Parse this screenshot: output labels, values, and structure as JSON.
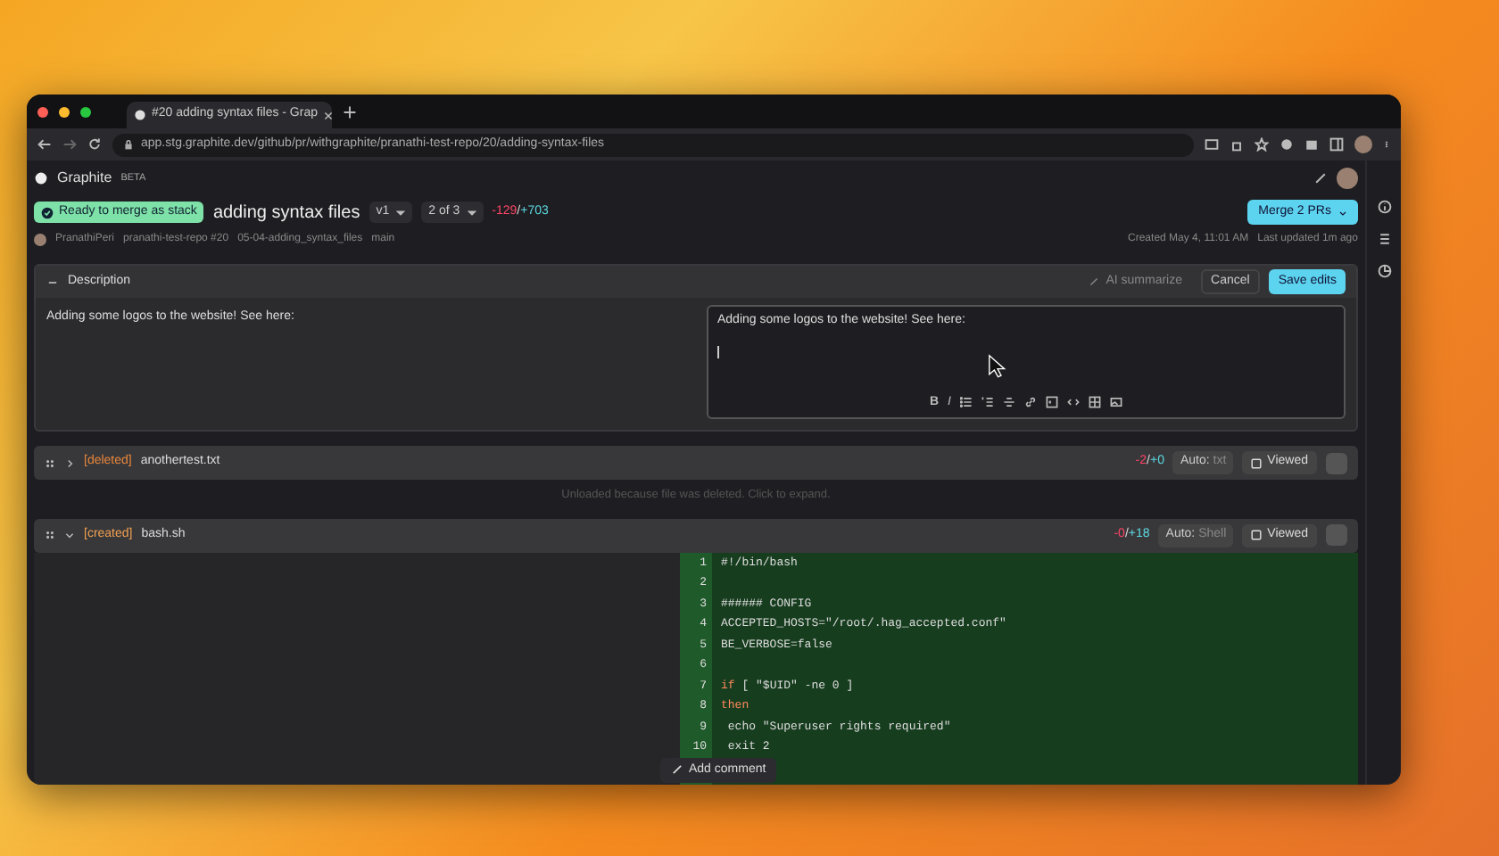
{
  "browser": {
    "tab_title": "#20 adding syntax files - Grap",
    "url": "app.stg.graphite.dev/github/pr/withgraphite/pranathi-test-repo/20/adding-syntax-files"
  },
  "app": {
    "name": "Graphite",
    "badge": "BETA"
  },
  "pr": {
    "status": "Ready to merge as stack",
    "title": "adding syntax files",
    "version": "v1",
    "stack_position": "2 of 3",
    "deletions": "-129",
    "separator": "/",
    "additions": "+703",
    "author": "PranathiPeri",
    "repo": "pranathi-test-repo #20",
    "branch": "05-04-adding_syntax_files",
    "base": "main",
    "created": "Created May 4, 11:01 AM",
    "updated": "Last updated 1m ago",
    "merge_button": "Merge 2 PRs"
  },
  "description": {
    "title": "Description",
    "expanded": true,
    "ai_button": "AI summarize",
    "cancel": "Cancel",
    "save": "Save edits",
    "preview": "Adding some logos to the website! See here:",
    "editor_value": "Adding some logos to the website! See here:",
    "toolbar": {
      "bold": "B",
      "italic": "I"
    }
  },
  "files": [
    {
      "kind": "deleted",
      "status_label": "[deleted]",
      "name": "anothertest.txt",
      "deletions": "-2",
      "separator": "/",
      "additions": "+0",
      "auto_label": "Auto:",
      "language": "txt",
      "viewed_label": "Viewed",
      "viewed": false,
      "expanded": false,
      "message": "Unloaded because file was deleted. Click to expand."
    },
    {
      "kind": "created",
      "status_label": "[created]",
      "name": "bash.sh",
      "deletions": "-0",
      "separator": "/",
      "additions": "+18",
      "auto_label": "Auto:",
      "language": "Shell",
      "viewed_label": "Viewed",
      "viewed": false,
      "expanded": true,
      "lines": [
        {
          "number": "1",
          "text": "#!/bin/bash"
        },
        {
          "number": "2"
        },
        {
          "number": "3",
          "text": "###### CONFIG"
        },
        {
          "number": "4",
          "text": "ACCEPTED_HOSTS=\"/root/.hag_accepted.conf\""
        },
        {
          "number": "5",
          "text": "BE_VERBOSE=false"
        },
        {
          "number": "6"
        },
        {
          "number": "7",
          "keyword": "if",
          "text": " [ \"$UID\" -ne 0 ]"
        },
        {
          "number": "8",
          "keyword": "then"
        },
        {
          "number": "9",
          "text": " echo \"Superuser rights required\""
        },
        {
          "number": "10",
          "text": " exit 2"
        }
      ]
    }
  ],
  "add_comment": "Add comment"
}
